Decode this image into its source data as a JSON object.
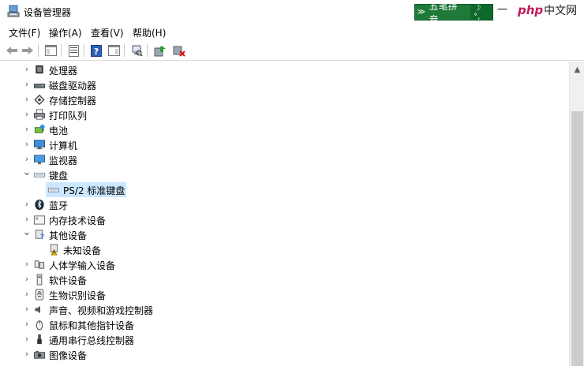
{
  "window": {
    "title": "设备管理器"
  },
  "ime": {
    "symbol": "≫",
    "label": "五笔拼音",
    "extra": "☽ °,"
  },
  "window_controls": {
    "minimize": "—"
  },
  "watermark": {
    "php": "php",
    "cn": "中文网"
  },
  "menu": [
    {
      "label": "文件(F)"
    },
    {
      "label": "操作(A)"
    },
    {
      "label": "查看(V)"
    },
    {
      "label": "帮助(H)"
    }
  ],
  "toolbar": {
    "buttons": [
      "back-icon",
      "forward-icon",
      "show-hide-tree-icon",
      "properties-icon",
      "help-icon",
      "action-pane-icon",
      "scan-hardware-icon",
      "update-driver-icon",
      "uninstall-device-icon"
    ]
  },
  "tree": {
    "items": [
      {
        "label": "处理器",
        "icon": "processor-icon",
        "level": 0,
        "expanded": false
      },
      {
        "label": "磁盘驱动器",
        "icon": "disk-drive-icon",
        "level": 0,
        "expanded": false
      },
      {
        "label": "存储控制器",
        "icon": "storage-controller-icon",
        "level": 0,
        "expanded": false
      },
      {
        "label": "打印队列",
        "icon": "printer-icon",
        "level": 0,
        "expanded": false
      },
      {
        "label": "电池",
        "icon": "battery-icon",
        "level": 0,
        "expanded": false
      },
      {
        "label": "计算机",
        "icon": "computer-icon",
        "level": 0,
        "expanded": false
      },
      {
        "label": "监视器",
        "icon": "monitor-icon",
        "level": 0,
        "expanded": false
      },
      {
        "label": "键盘",
        "icon": "keyboard-icon",
        "level": 0,
        "expanded": true
      },
      {
        "label": "PS/2 标准键盘",
        "icon": "keyboard-icon",
        "level": 1,
        "selected": true
      },
      {
        "label": "蓝牙",
        "icon": "bluetooth-icon",
        "level": 0,
        "expanded": false
      },
      {
        "label": "内存技术设备",
        "icon": "memory-device-icon",
        "level": 0,
        "expanded": false
      },
      {
        "label": "其他设备",
        "icon": "other-devices-icon",
        "level": 0,
        "expanded": true
      },
      {
        "label": "未知设备",
        "icon": "unknown-device-warning-icon",
        "level": 1
      },
      {
        "label": "人体学输入设备",
        "icon": "hid-icon",
        "level": 0,
        "expanded": false
      },
      {
        "label": "软件设备",
        "icon": "software-device-icon",
        "level": 0,
        "expanded": false
      },
      {
        "label": "生物识别设备",
        "icon": "biometric-icon",
        "level": 0,
        "expanded": false
      },
      {
        "label": "声音、视频和游戏控制器",
        "icon": "speaker-icon",
        "level": 0,
        "expanded": false
      },
      {
        "label": "鼠标和其他指针设备",
        "icon": "mouse-icon",
        "level": 0,
        "expanded": false
      },
      {
        "label": "通用串行总线控制器",
        "icon": "usb-icon",
        "level": 0,
        "expanded": false
      },
      {
        "label": "图像设备",
        "icon": "imaging-device-icon",
        "level": 0,
        "expanded": false
      }
    ]
  }
}
